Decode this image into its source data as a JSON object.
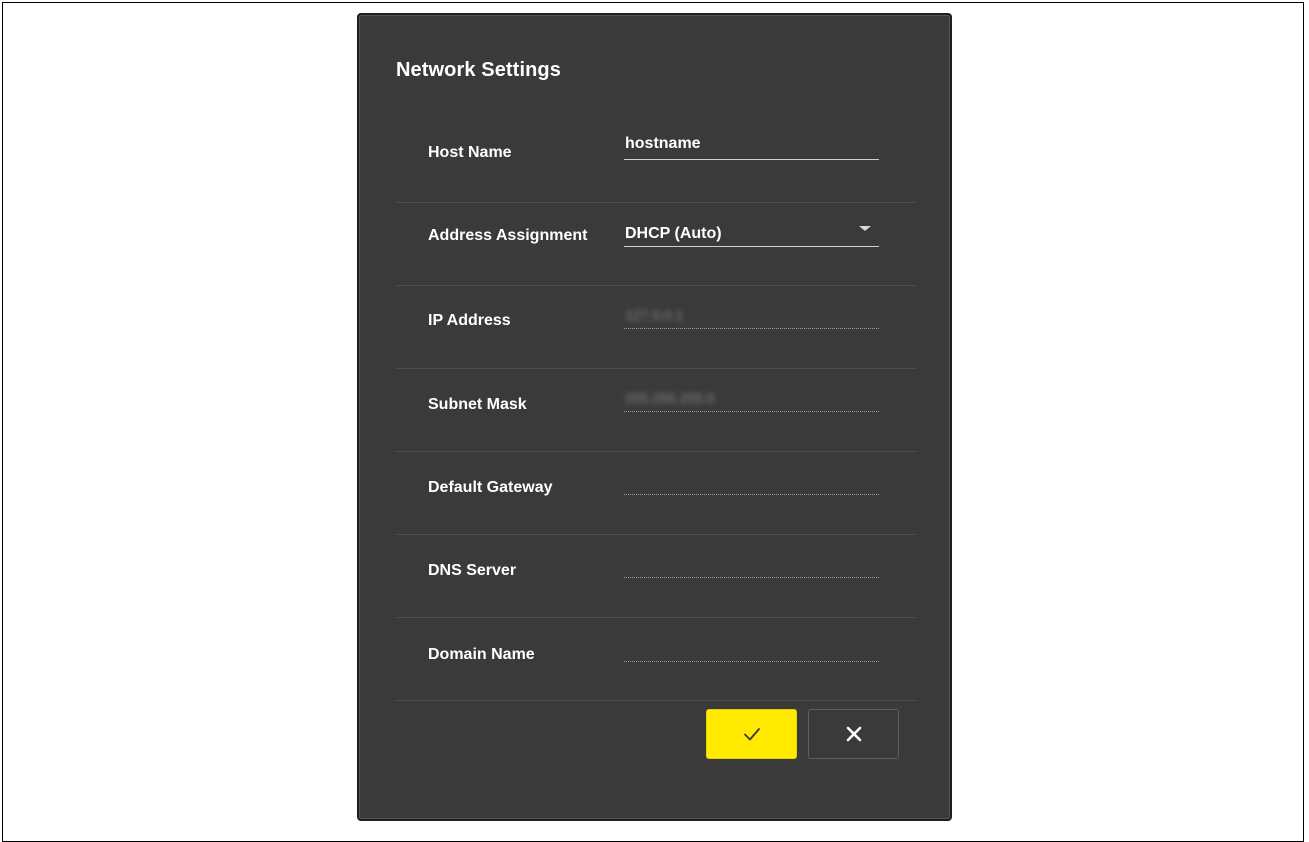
{
  "dialog": {
    "title": "Network Settings",
    "fields": [
      {
        "label": "Host Name",
        "value": "hostname"
      },
      {
        "label": "Address Assignment",
        "value": "DHCP (Auto)"
      },
      {
        "label": "IP Address",
        "value": "127.0.0.1"
      },
      {
        "label": "Subnet Mask",
        "value": "255.255.255.0"
      },
      {
        "label": "Default Gateway",
        "value": ""
      },
      {
        "label": "DNS Server",
        "value": ""
      },
      {
        "label": "Domain Name",
        "value": ""
      }
    ],
    "confirm_icon": "check-icon",
    "cancel_icon": "close-icon",
    "accent_color": "#ffea00"
  }
}
